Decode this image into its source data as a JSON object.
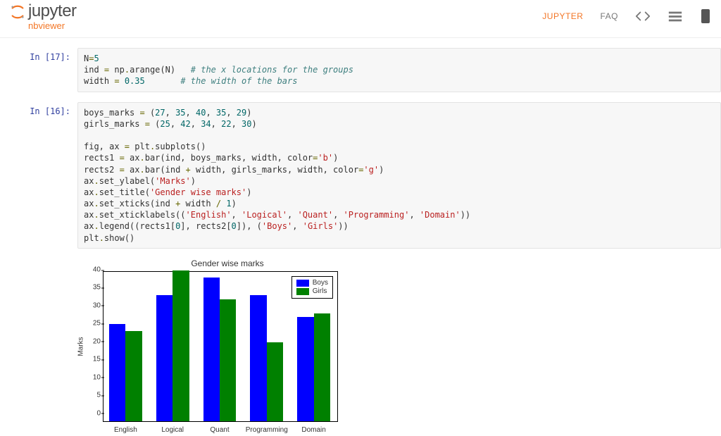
{
  "header": {
    "logo_main": "jupyter",
    "logo_sub": "nbviewer",
    "nav": {
      "jupyter": "JUPYTER",
      "faq": "FAQ"
    }
  },
  "cells": [
    {
      "prompt": "In [17]:",
      "code": {
        "l0a": "N",
        "l0b": "=",
        "l0c": "5",
        "l1a": "ind ",
        "l1b": "=",
        "l1c": " np",
        "l1d": ".",
        "l1e": "arange(N)   ",
        "l1cmt": "# the x locations for the groups",
        "l2a": "width ",
        "l2b": "=",
        "l2c": " ",
        "l2d": "0.35",
        "l2e": "       ",
        "l2cmt": "# the width of the bars"
      }
    },
    {
      "prompt": "In [16]:",
      "code": {
        "l0a": "boys_marks ",
        "l0b": "=",
        "l0c": " (",
        "l0n1": "27",
        "l0s1": ", ",
        "l0n2": "35",
        "l0s2": ", ",
        "l0n3": "40",
        "l0s3": ", ",
        "l0n4": "35",
        "l0s4": ", ",
        "l0n5": "29",
        "l0d": ")",
        "l1a": "girls_marks ",
        "l1b": "=",
        "l1c": " (",
        "l1n1": "25",
        "l1s1": ", ",
        "l1n2": "42",
        "l1s2": ", ",
        "l1n3": "34",
        "l1s3": ", ",
        "l1n4": "22",
        "l1s4": ", ",
        "l1n5": "30",
        "l1d": ")",
        "l2": "",
        "l3a": "fig, ax ",
        "l3b": "=",
        "l3c": " plt",
        "l3d": ".",
        "l3e": "subplots()",
        "l4a": "rects1 ",
        "l4b": "=",
        "l4c": " ax",
        "l4d": ".",
        "l4e": "bar(ind, boys_marks, width, color",
        "l4f": "=",
        "l4g": "'b'",
        "l4h": ")",
        "l5a": "rects2 ",
        "l5b": "=",
        "l5c": " ax",
        "l5d": ".",
        "l5e": "bar(ind ",
        "l5f": "+",
        "l5g": " width, girls_marks, width, color",
        "l5h": "=",
        "l5i": "'g'",
        "l5j": ")",
        "l6a": "ax",
        "l6b": ".",
        "l6c": "set_ylabel(",
        "l6d": "'Marks'",
        "l6e": ")",
        "l7a": "ax",
        "l7b": ".",
        "l7c": "set_title(",
        "l7d": "'Gender wise marks'",
        "l7e": ")",
        "l8a": "ax",
        "l8b": ".",
        "l8c": "set_xticks(ind ",
        "l8d": "+",
        "l8e": " width ",
        "l8f": "/",
        "l8g": " ",
        "l8h": "1",
        "l8i": ")",
        "l9a": "ax",
        "l9b": ".",
        "l9c": "set_xticklabels((",
        "l9s1": "'English'",
        "l9c1": ", ",
        "l9s2": "'Logical'",
        "l9c2": ", ",
        "l9s3": "'Quant'",
        "l9c3": ", ",
        "l9s4": "'Programming'",
        "l9c4": ", ",
        "l9s5": "'Domain'",
        "l9d": "))",
        "l10a": "ax",
        "l10b": ".",
        "l10c": "legend((rects1[",
        "l10d": "0",
        "l10e": "], rects2[",
        "l10f": "0",
        "l10g": "]), (",
        "l10h": "'Boys'",
        "l10i": ", ",
        "l10j": "'Girls'",
        "l10k": "))",
        "l11a": "plt",
        "l11b": ".",
        "l11c": "show()"
      }
    }
  ],
  "chart_data": {
    "type": "bar",
    "title": "Gender wise marks",
    "ylabel": "Marks",
    "xlabel": "",
    "categories": [
      "English",
      "Logical",
      "Quant",
      "Programming",
      "Domain"
    ],
    "series": [
      {
        "name": "Boys",
        "values": [
          27,
          35,
          40,
          35,
          29
        ],
        "color": "#0000ff"
      },
      {
        "name": "Girls",
        "values": [
          25,
          42,
          34,
          22,
          30
        ],
        "color": "#008000"
      }
    ],
    "ylim": [
      0,
      42
    ],
    "yticks": [
      0,
      5,
      10,
      15,
      20,
      25,
      30,
      35,
      40
    ],
    "legend_labels": {
      "boys": "Boys",
      "girls": "Girls"
    }
  }
}
